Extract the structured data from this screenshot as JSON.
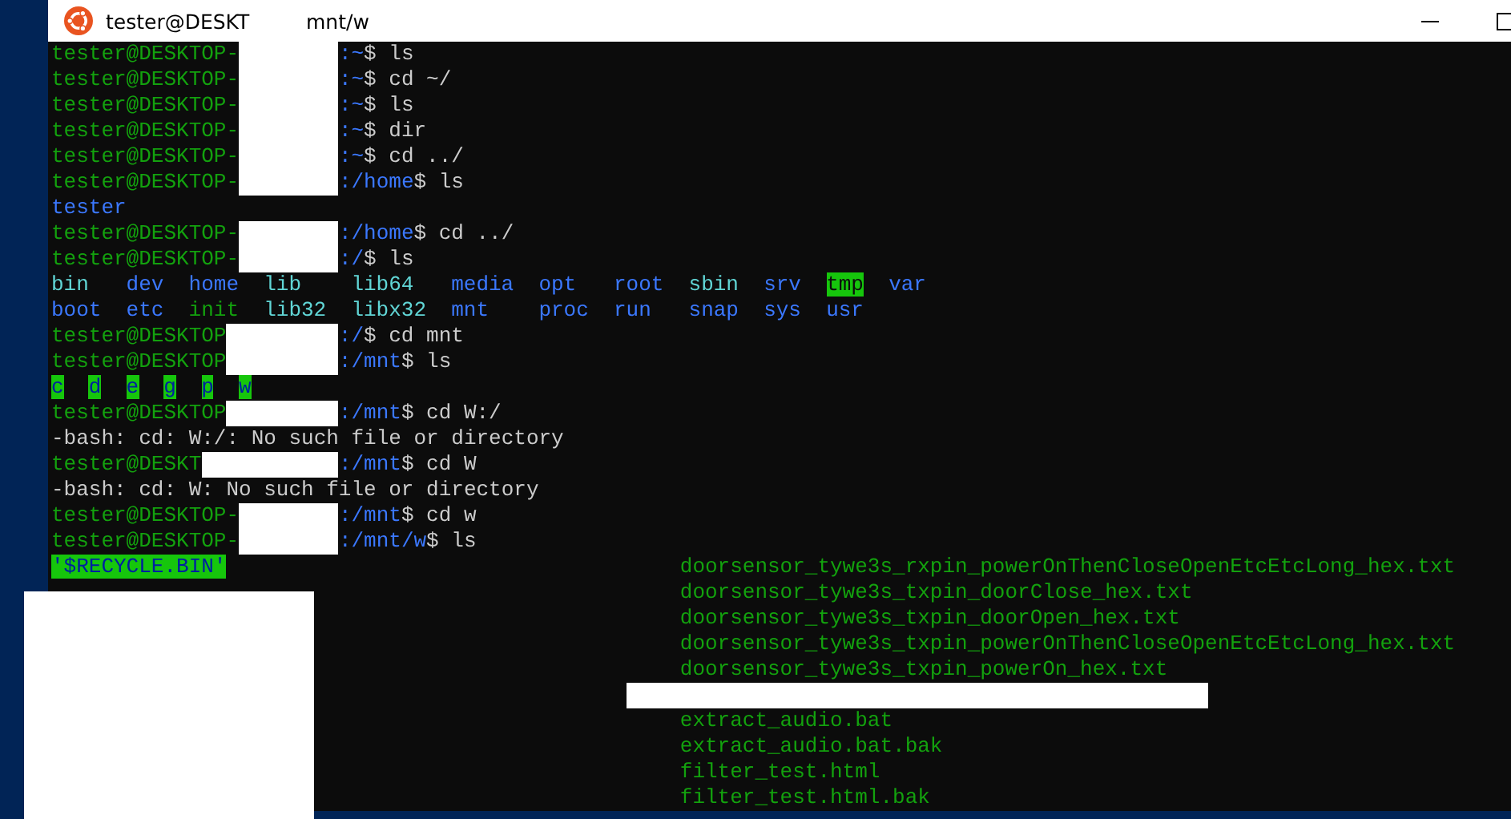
{
  "window": {
    "title_parts": [
      "tester@DESKT",
      "mnt/w"
    ]
  },
  "terminal": {
    "lines": [
      {
        "kind": "prompt",
        "user": "tester@DESKTOP-",
        "path": ":~",
        "command": "$ ls"
      },
      {
        "kind": "prompt",
        "user": "tester@DESKTOP-",
        "path": ":~",
        "command": "$ cd ~/"
      },
      {
        "kind": "prompt",
        "user": "tester@DESKTOP-",
        "path": ":~",
        "command": "$ ls"
      },
      {
        "kind": "prompt",
        "user": "tester@DESKTOP-",
        "path": ":~",
        "command": "$ dir"
      },
      {
        "kind": "prompt",
        "user": "tester@DESKTOP-",
        "path": ":~",
        "command": "$ cd ../"
      },
      {
        "kind": "prompt",
        "user": "tester@DESKTOP-",
        "path": ":/home",
        "command": "$ ls"
      },
      {
        "kind": "ls",
        "rows": [
          [
            {
              "name": "tester",
              "kind": "dir"
            }
          ]
        ]
      },
      {
        "kind": "prompt",
        "user": "tester@DESKTOP-",
        "path": ":/home",
        "command": "$ cd ../"
      },
      {
        "kind": "prompt",
        "user": "tester@DESKTOP-",
        "path": ":/",
        "command": "$ ls"
      },
      {
        "kind": "ls",
        "rows": [
          [
            {
              "name": "bin",
              "kind": "link"
            },
            {
              "name": "dev",
              "kind": "dir"
            },
            {
              "name": "home",
              "kind": "dir"
            },
            {
              "name": "lib",
              "kind": "link"
            },
            {
              "name": "lib64",
              "kind": "link"
            },
            {
              "name": "media",
              "kind": "dir"
            },
            {
              "name": "opt",
              "kind": "dir"
            },
            {
              "name": "root",
              "kind": "dir"
            },
            {
              "name": "sbin",
              "kind": "link"
            },
            {
              "name": "srv",
              "kind": "dir"
            },
            {
              "name": "tmp",
              "kind": "sticky"
            },
            {
              "name": "var",
              "kind": "dir"
            }
          ],
          [
            {
              "name": "boot",
              "kind": "dir"
            },
            {
              "name": "etc",
              "kind": "dir"
            },
            {
              "name": "init",
              "kind": "exec"
            },
            {
              "name": "lib32",
              "kind": "link"
            },
            {
              "name": "libx32",
              "kind": "link"
            },
            {
              "name": "mnt",
              "kind": "dir"
            },
            {
              "name": "proc",
              "kind": "dir"
            },
            {
              "name": "run",
              "kind": "dir"
            },
            {
              "name": "snap",
              "kind": "dir"
            },
            {
              "name": "sys",
              "kind": "dir"
            },
            {
              "name": "usr",
              "kind": "dir"
            }
          ]
        ]
      },
      {
        "kind": "prompt",
        "user": "tester@DESKTOP",
        "path": ":/",
        "command": "$ cd mnt"
      },
      {
        "kind": "prompt",
        "user": "tester@DESKTOP",
        "path": ":/mnt",
        "command": "$ ls"
      },
      {
        "kind": "ls",
        "rows": [
          [
            {
              "name": "c",
              "kind": "writable"
            },
            {
              "name": "d",
              "kind": "writable"
            },
            {
              "name": "e",
              "kind": "writable"
            },
            {
              "name": "g",
              "kind": "writable"
            },
            {
              "name": "p",
              "kind": "writable"
            },
            {
              "name": "w",
              "kind": "writable"
            }
          ]
        ]
      },
      {
        "kind": "prompt",
        "user": "tester@DESKTOP",
        "path": ":/mnt",
        "command": "$ cd W:/"
      },
      {
        "kind": "output",
        "text": "-bash: cd: W:/: No such file or directory"
      },
      {
        "kind": "prompt",
        "user": "tester@DESKT",
        "path": ":/mnt",
        "command": "$ cd W"
      },
      {
        "kind": "output",
        "text": "-bash: cd: W: No such file or directory"
      },
      {
        "kind": "prompt",
        "user": "tester@DESKTOP-",
        "path": ":/mnt",
        "command": "$ cd w"
      },
      {
        "kind": "prompt",
        "user": "tester@DESKTOP-",
        "path": ":/mnt/w",
        "command": "$ ls"
      },
      {
        "kind": "listing",
        "rows": [
          {
            "left": {
              "name": "'$RECYCLE.BIN'",
              "kind": "writable"
            },
            "right": {
              "name": "doorsensor_tywe3s_rxpin_powerOnThenCloseOpenEtcEtcLong_hex.txt",
              "kind": "exec"
            }
          },
          {
            "right": {
              "name": "doorsensor_tywe3s_txpin_doorClose_hex.txt",
              "kind": "exec"
            }
          },
          {
            "right": {
              "name": "doorsensor_tywe3s_txpin_doorOpen_hex.txt",
              "kind": "exec"
            }
          },
          {
            "right": {
              "name": "doorsensor_tywe3s_txpin_powerOnThenCloseOpenEtcEtcLong_hex.txt",
              "kind": "exec"
            }
          },
          {
            "right": {
              "name": "doorsensor_tywe3s_txpin_powerOn_hex.txt",
              "kind": "exec"
            }
          },
          {
            "redacted": true
          },
          {
            "right": {
              "name": "extract_audio.bat",
              "kind": "exec"
            }
          },
          {
            "right": {
              "name": "extract_audio.bat.bak",
              "kind": "exec"
            }
          },
          {
            "right": {
              "name": "filter_test.html",
              "kind": "exec"
            }
          },
          {
            "right": {
              "name": "filter_test.html.bak",
              "kind": "exec"
            }
          }
        ]
      }
    ]
  }
}
